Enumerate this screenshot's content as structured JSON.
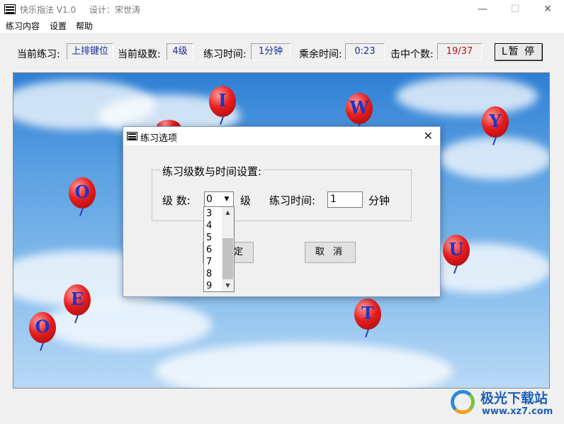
{
  "window": {
    "title": "快乐指法 V1.0",
    "designer": "设计：宋世涛",
    "minimize_glyph": "—",
    "maximize_glyph": "☐",
    "close_glyph": "✕"
  },
  "menu": {
    "items": [
      "练习内容",
      "设置",
      "帮助"
    ]
  },
  "status": {
    "current_practice_label": "当前练习:",
    "current_practice_value": "上排键位",
    "current_level_label": "当前级数:",
    "current_level_value": "4级",
    "practice_time_label": "练习时间:",
    "practice_time_value": "1分钟",
    "remaining_time_label": "乘余时间:",
    "remaining_time_value": "0:23",
    "hits_label": "击中个数:",
    "hits_value": "19/37",
    "pause_button": "L暂 停"
  },
  "balloons": [
    {
      "letter": "I"
    },
    {
      "letter": "W"
    },
    {
      "letter": "Y"
    },
    {
      "letter": "O"
    },
    {
      "letter": "U"
    },
    {
      "letter": "E"
    },
    {
      "letter": "T"
    },
    {
      "letter": "O"
    }
  ],
  "dialog": {
    "title": "练习选项",
    "close_glyph": "✕",
    "group_title": "练习级数与时间设置:",
    "level_label": "级  数:",
    "level_value": "0",
    "level_unit": "级",
    "time_label": "练习时间:",
    "time_value": "1",
    "time_unit": "分钟",
    "ok_button": "定",
    "cancel_button": "取 消",
    "dropdown_options": [
      "3",
      "4",
      "5",
      "6",
      "7",
      "8",
      "9"
    ]
  },
  "watermark": {
    "name": "极光下载站",
    "url": "www.xz7.com"
  },
  "colors": {
    "balloon": "#e61e1e",
    "balloon_letter": "#1a35c8",
    "hits_value": "#c0101a",
    "status_value": "#1a2aa0",
    "sky": "#5aa0e2"
  }
}
